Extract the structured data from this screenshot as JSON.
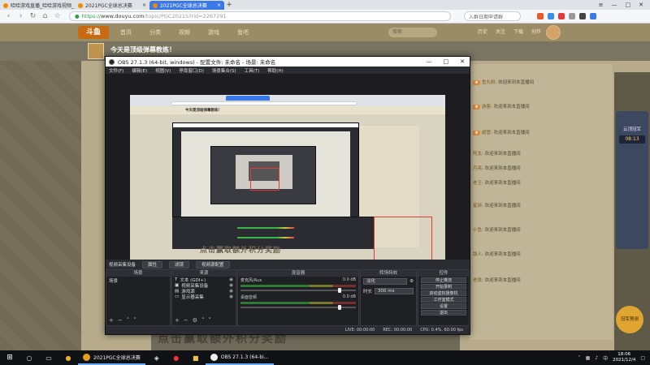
{
  "browser": {
    "tabs": [
      {
        "label": "哈哈游戏直播_哈哈游戏视频_",
        "active": false
      },
      {
        "label": "2021PGC全球总决赛",
        "active": false
      },
      {
        "label": "2021PGC全球总决赛",
        "active": true
      }
    ],
    "url_scheme": "https://",
    "url_host": "www.douyu.com",
    "url_path": "/topic/PGC2021S?rid=2267291",
    "search_placeholder": "入群日期申请群"
  },
  "douyu": {
    "logo": "斗鱼",
    "nav": [
      "首页",
      "分类",
      "视频",
      "游戏",
      "鱼吧"
    ],
    "header_search": "搜索",
    "header_right": [
      "历史",
      "关注",
      "下载",
      "创作"
    ],
    "room_title": "今天是顶级弹幕教练！",
    "chat": [
      {
        "who": "鱼丸粉",
        "text": "欢迎来到本直播间"
      },
      {
        "who": "游客",
        "text": "欢迎来到本直播间"
      },
      {
        "who": "超管",
        "text": "欢迎来到本直播间"
      },
      {
        "who": "阿龙",
        "text": "欢迎来到本直播间"
      },
      {
        "who": "月亮",
        "text": "欢迎来到本直播间"
      },
      {
        "who": "老王",
        "text": "欢迎来到本直播间"
      },
      {
        "who": "星辰",
        "text": "欢迎来到本直播间"
      },
      {
        "who": "小鱼",
        "text": "欢迎来到本直播间"
      },
      {
        "who": "路人",
        "text": "欢迎来到本直播间"
      },
      {
        "who": "老铁",
        "text": "欢迎来到本直播间"
      }
    ],
    "side_title": "云顶冠军",
    "side_timer": "08:13",
    "bottom_banner": "点击赢取额外积分奖励",
    "side_badge": "冠军预测"
  },
  "obs": {
    "title": "OBS 27.1.3 (64-bit, windows) - 配置文件: 未命名 - 场景: 未命名",
    "menu": [
      "文件(F)",
      "编辑(E)",
      "视图(V)",
      "停靠窗口(D)",
      "场景集合(S)",
      "工具(T)",
      "帮助(H)"
    ],
    "source_bar_label": "视频采集设备",
    "source_bar_buttons": [
      "属性",
      "滤镜",
      "视频源配置"
    ],
    "docks": {
      "scenes": {
        "title": "场景",
        "items": [
          "场景"
        ]
      },
      "sources": {
        "title": "来源",
        "items": [
          "文本 (GDI+)",
          "视频采集设备",
          "游戏源",
          "显示器采集"
        ]
      },
      "mixer": {
        "title": "混音器",
        "channels": [
          {
            "name": "麦克风/Aux",
            "db": "0.0 dB"
          },
          {
            "name": "桌面音频",
            "db": "0.0 dB"
          }
        ]
      },
      "transitions": {
        "title": "转场特效",
        "type": "淡化",
        "duration_label": "时长",
        "duration": "300 ms"
      },
      "controls": {
        "title": "控件",
        "buttons": [
          "停止推流",
          "开始录制",
          "启动虚拟摄像机",
          "工作室模式",
          "设置",
          "退出"
        ]
      }
    },
    "status": [
      "LIVE: 00:00:00",
      "REC: 00:00:00",
      "CPU: 0.4%, 60.00 fps"
    ]
  },
  "preview": {
    "title": "今天是顶级弹幕教练！",
    "text": "点击赢取额外积分奖励"
  },
  "taskbar": {
    "apps": [
      {
        "label": "2021PGC全球总决赛",
        "color": "#e3a21a"
      },
      {
        "label": "OBS 27.1.3 (64-bi...",
        "color": "#eeeeee"
      }
    ],
    "time": "18:06",
    "date": "2021/12/4",
    "ime": "中"
  }
}
